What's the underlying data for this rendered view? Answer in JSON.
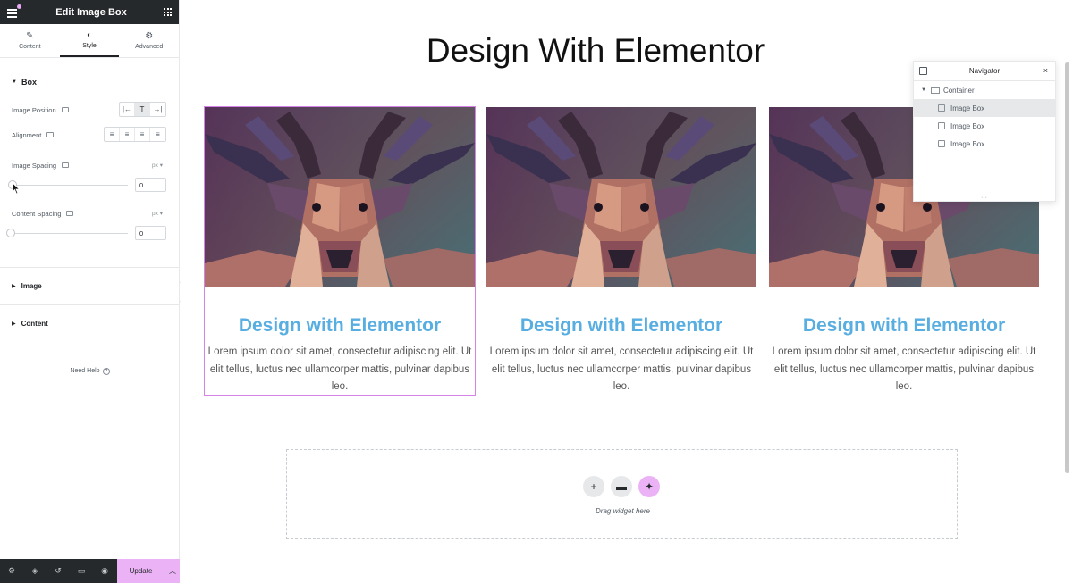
{
  "panel": {
    "title": "Edit Image Box",
    "tabs": [
      {
        "label": "Content",
        "icon": "pencil-icon"
      },
      {
        "label": "Style",
        "icon": "half-circle-icon"
      },
      {
        "label": "Advanced",
        "icon": "gear-icon"
      }
    ],
    "active_tab": "Style",
    "section_box": "Box",
    "image_position_label": "Image Position",
    "alignment_label": "Alignment",
    "image_spacing_label": "Image Spacing",
    "image_spacing_unit": "px",
    "image_spacing_value": "0",
    "content_spacing_label": "Content Spacing",
    "content_spacing_unit": "px",
    "content_spacing_value": "0",
    "section_image": "Image",
    "section_content": "Content",
    "need_help": "Need Help",
    "update_label": "Update"
  },
  "canvas": {
    "heading": "Design With Elementor",
    "cards": [
      {
        "title": "Design with Elementor",
        "text": "Lorem ipsum dolor sit amet, consectetur adipiscing elit. Ut elit tellus, luctus nec ullamcorper mattis, pulvinar dapibus leo."
      },
      {
        "title": "Design with Elementor",
        "text": "Lorem ipsum dolor sit amet, consectetur adipiscing elit. Ut elit tellus, luctus nec ullamcorper mattis, pulvinar dapibus leo."
      },
      {
        "title": "Design with Elementor",
        "text": "Lorem ipsum dolor sit amet, consectetur adipiscing elit. Ut elit tellus, luctus nec ullamcorper mattis, pulvinar dapibus leo."
      }
    ],
    "drag_text": "Drag widget here"
  },
  "navigator": {
    "title": "Navigator",
    "container": "Container",
    "items": [
      "Image Box",
      "Image Box",
      "Image Box"
    ]
  },
  "colors": {
    "accent": "#ebb2f5",
    "title_blue": "#58aee1",
    "dark": "#26292c"
  }
}
